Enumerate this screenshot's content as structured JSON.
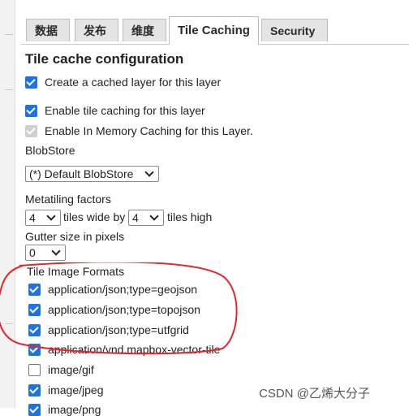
{
  "tabs": [
    {
      "label": "数据"
    },
    {
      "label": "发布"
    },
    {
      "label": "维度"
    },
    {
      "label": "Tile Caching",
      "active": true
    },
    {
      "label": "Security"
    }
  ],
  "section_title": "Tile cache configuration",
  "options": {
    "create_cached_layer": {
      "label": "Create a cached layer for this layer",
      "checked": true
    },
    "enable_tile_caching": {
      "label": "Enable tile caching for this layer",
      "checked": true
    },
    "enable_in_memory": {
      "label": "Enable In Memory Caching for this Layer.",
      "checked": true,
      "disabled": true
    }
  },
  "blobstore": {
    "label": "BlobStore",
    "selected": "(*) Default BlobStore"
  },
  "metatiling": {
    "label": "Metatiling factors",
    "wide_value": "4",
    "wide_text": "tiles wide by",
    "high_value": "4",
    "high_text": "tiles high"
  },
  "gutter": {
    "label": "Gutter size in pixels",
    "value": "0"
  },
  "formats": {
    "label": "Tile Image Formats",
    "items": [
      {
        "label": "application/json;type=geojson",
        "checked": true
      },
      {
        "label": "application/json;type=topojson",
        "checked": true
      },
      {
        "label": "application/json;type=utfgrid",
        "checked": true
      },
      {
        "label": "application/vnd.mapbox-vector-tile",
        "checked": true
      },
      {
        "label": "image/gif",
        "checked": false
      },
      {
        "label": "image/jpeg",
        "checked": true
      },
      {
        "label": "image/png",
        "checked": true
      }
    ]
  },
  "annotation_color": "#e8232a",
  "watermark": "CSDN @乙烯大分子"
}
